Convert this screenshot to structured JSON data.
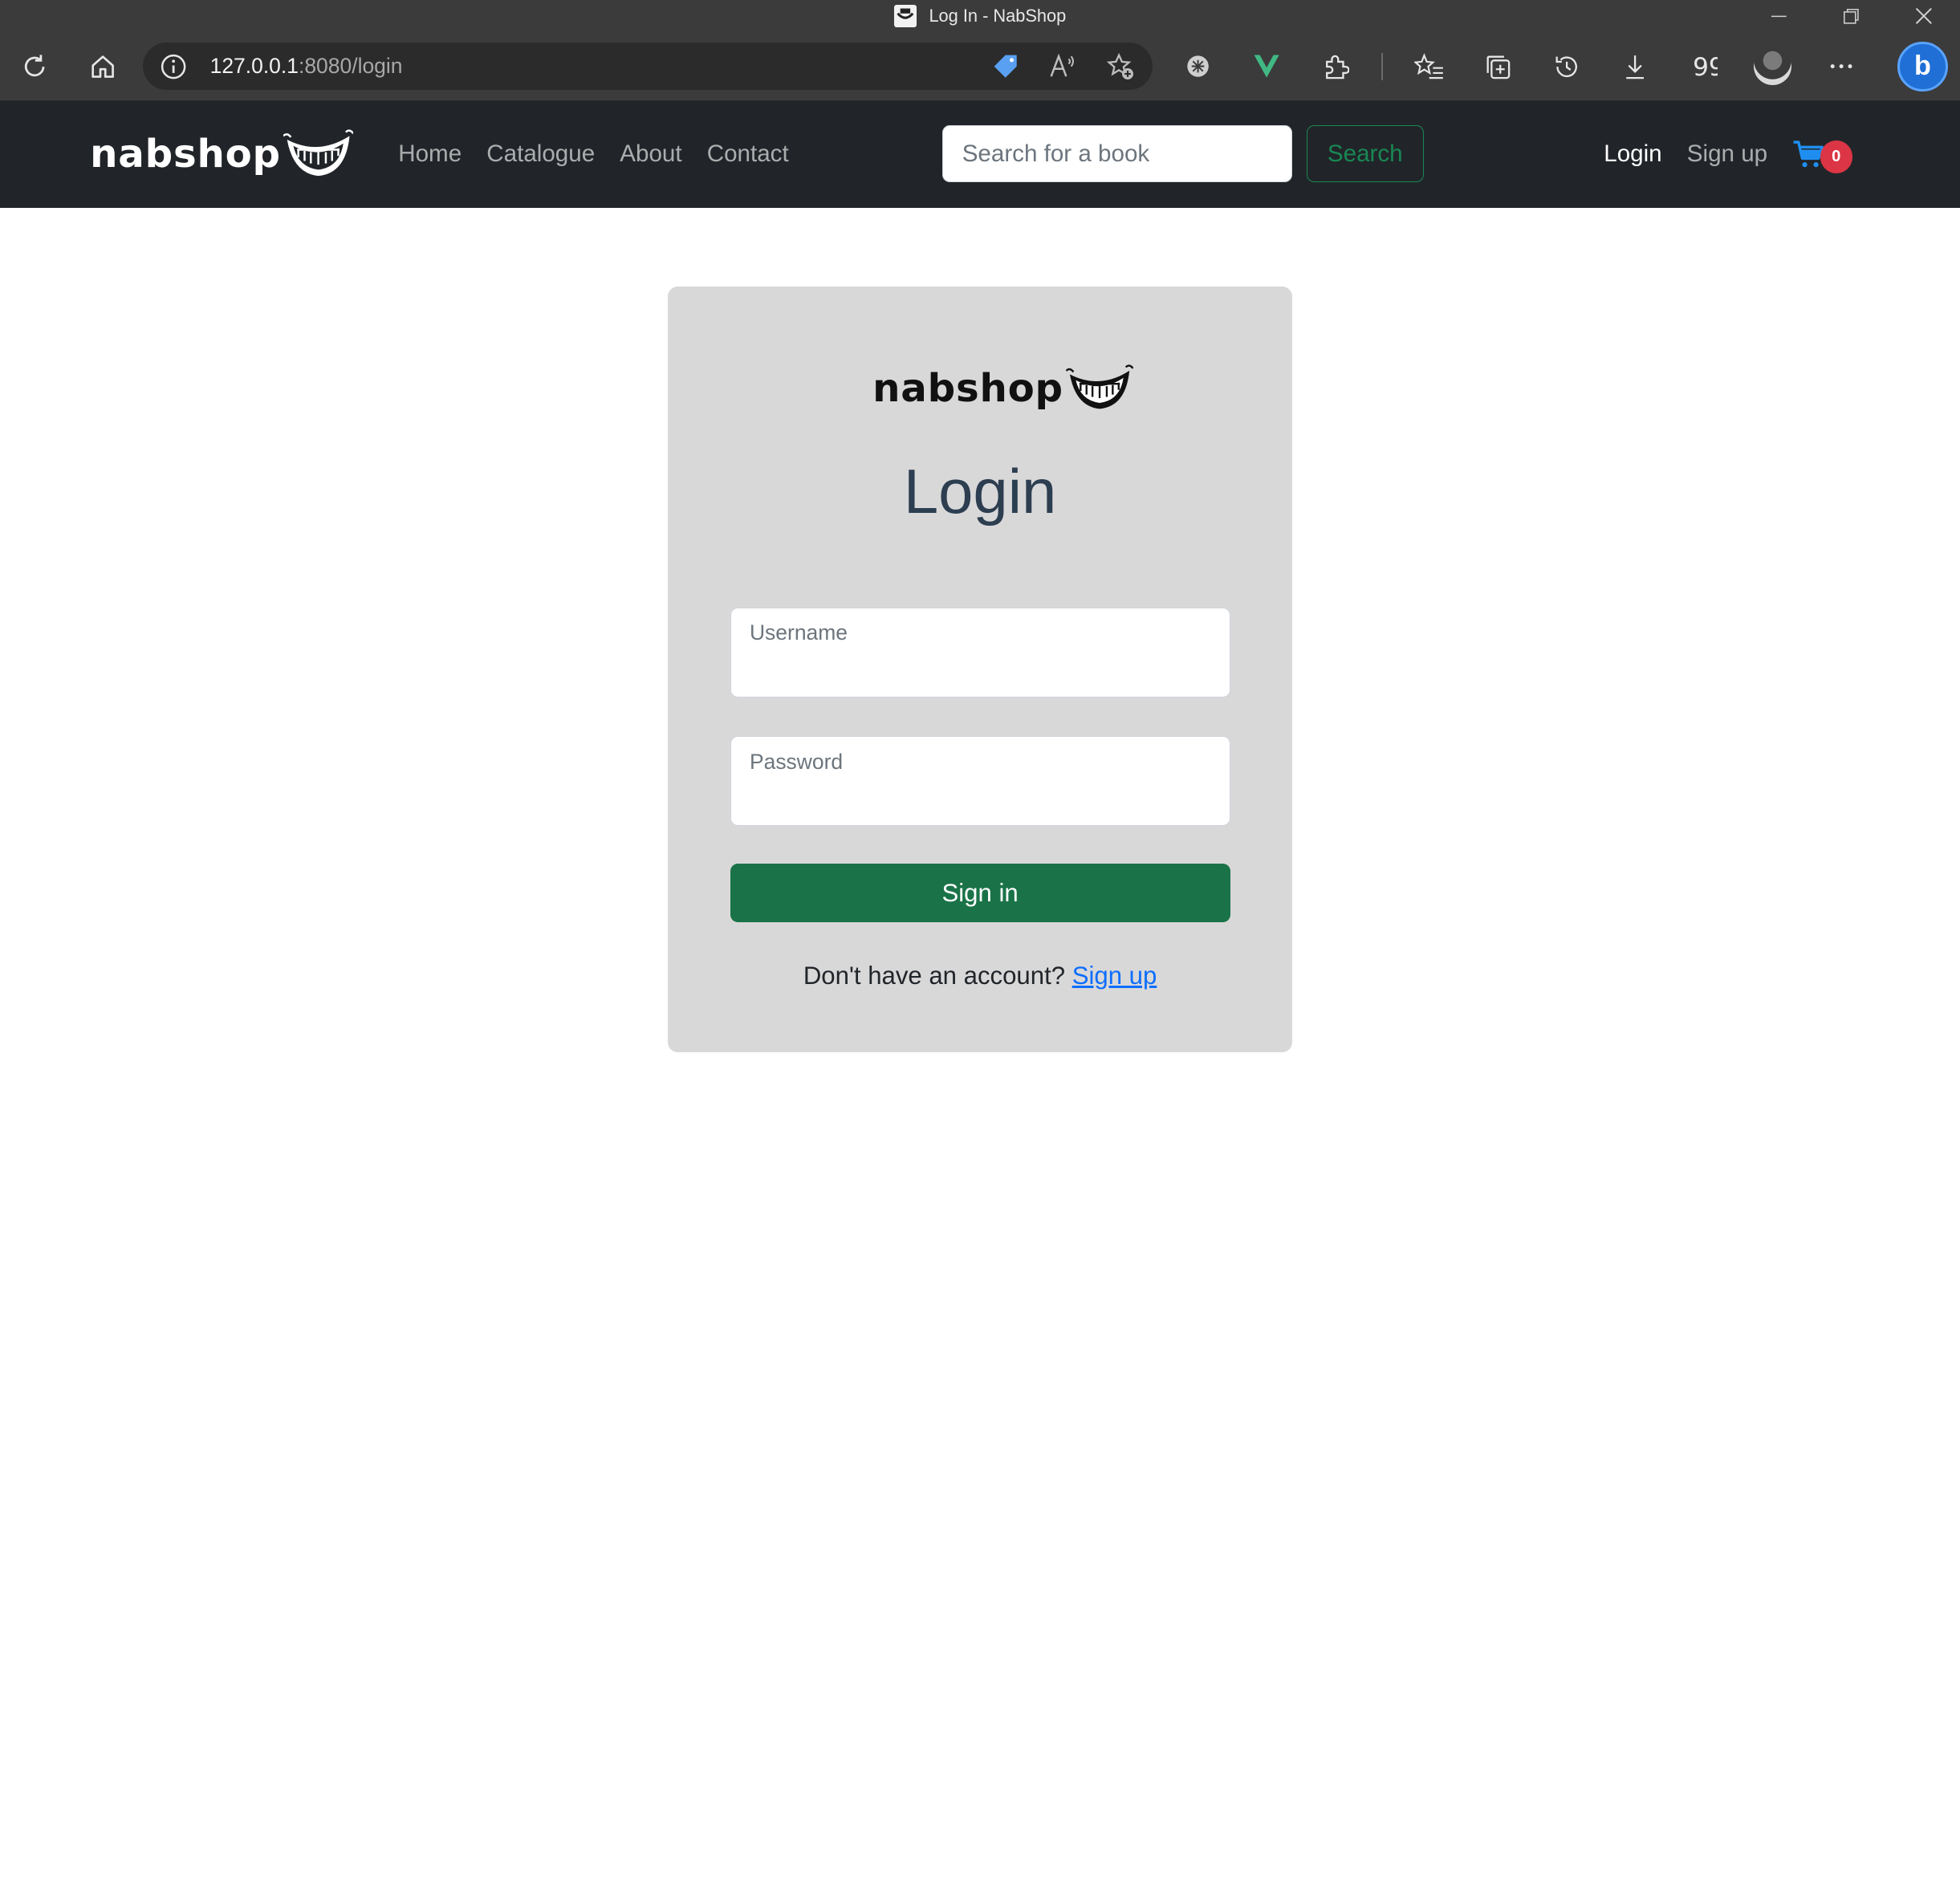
{
  "browser": {
    "tab_title": "Log In - NabShop",
    "url_host": "127.0.0.1",
    "url_path": ":8080/login"
  },
  "navbar": {
    "brand": "nabshop",
    "links": [
      "Home",
      "Catalogue",
      "About",
      "Contact"
    ],
    "search_placeholder": "Search for a book",
    "search_button": "Search",
    "login": "Login",
    "signup": "Sign up",
    "cart_count": "0"
  },
  "login_card": {
    "brand": "nabshop",
    "title": "Login",
    "username_label": "Username",
    "password_label": "Password",
    "submit": "Sign in",
    "no_account_text": "Don't have an account?",
    "signup_link": "Sign up"
  },
  "colors": {
    "navbar_bg": "#212529",
    "card_bg": "#d9d8d9",
    "primary_green": "#1a7348",
    "outline_green": "#198754",
    "badge_red": "#dc3545",
    "link_blue": "#0d6efd"
  },
  "icons": {
    "refresh": "refresh-icon",
    "home": "home-icon",
    "info": "info-icon",
    "cart": "cart-icon",
    "logo": "smile-logo-icon"
  }
}
